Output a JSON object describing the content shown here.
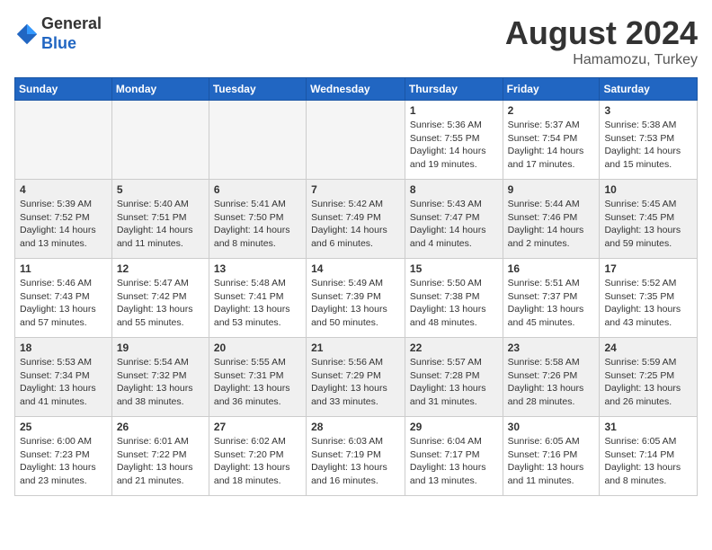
{
  "header": {
    "logo_line1": "General",
    "logo_line2": "Blue",
    "month_year": "August 2024",
    "location": "Hamamozu, Turkey"
  },
  "weekdays": [
    "Sunday",
    "Monday",
    "Tuesday",
    "Wednesday",
    "Thursday",
    "Friday",
    "Saturday"
  ],
  "weeks": [
    [
      {
        "day": "",
        "empty": true
      },
      {
        "day": "",
        "empty": true
      },
      {
        "day": "",
        "empty": true
      },
      {
        "day": "",
        "empty": true
      },
      {
        "day": "1",
        "sunrise": "5:36 AM",
        "sunset": "7:55 PM",
        "daylight": "14 hours and 19 minutes."
      },
      {
        "day": "2",
        "sunrise": "5:37 AM",
        "sunset": "7:54 PM",
        "daylight": "14 hours and 17 minutes."
      },
      {
        "day": "3",
        "sunrise": "5:38 AM",
        "sunset": "7:53 PM",
        "daylight": "14 hours and 15 minutes."
      }
    ],
    [
      {
        "day": "4",
        "sunrise": "5:39 AM",
        "sunset": "7:52 PM",
        "daylight": "14 hours and 13 minutes."
      },
      {
        "day": "5",
        "sunrise": "5:40 AM",
        "sunset": "7:51 PM",
        "daylight": "14 hours and 11 minutes."
      },
      {
        "day": "6",
        "sunrise": "5:41 AM",
        "sunset": "7:50 PM",
        "daylight": "14 hours and 8 minutes."
      },
      {
        "day": "7",
        "sunrise": "5:42 AM",
        "sunset": "7:49 PM",
        "daylight": "14 hours and 6 minutes."
      },
      {
        "day": "8",
        "sunrise": "5:43 AM",
        "sunset": "7:47 PM",
        "daylight": "14 hours and 4 minutes."
      },
      {
        "day": "9",
        "sunrise": "5:44 AM",
        "sunset": "7:46 PM",
        "daylight": "14 hours and 2 minutes."
      },
      {
        "day": "10",
        "sunrise": "5:45 AM",
        "sunset": "7:45 PM",
        "daylight": "13 hours and 59 minutes."
      }
    ],
    [
      {
        "day": "11",
        "sunrise": "5:46 AM",
        "sunset": "7:43 PM",
        "daylight": "13 hours and 57 minutes."
      },
      {
        "day": "12",
        "sunrise": "5:47 AM",
        "sunset": "7:42 PM",
        "daylight": "13 hours and 55 minutes."
      },
      {
        "day": "13",
        "sunrise": "5:48 AM",
        "sunset": "7:41 PM",
        "daylight": "13 hours and 53 minutes."
      },
      {
        "day": "14",
        "sunrise": "5:49 AM",
        "sunset": "7:39 PM",
        "daylight": "13 hours and 50 minutes."
      },
      {
        "day": "15",
        "sunrise": "5:50 AM",
        "sunset": "7:38 PM",
        "daylight": "13 hours and 48 minutes."
      },
      {
        "day": "16",
        "sunrise": "5:51 AM",
        "sunset": "7:37 PM",
        "daylight": "13 hours and 45 minutes."
      },
      {
        "day": "17",
        "sunrise": "5:52 AM",
        "sunset": "7:35 PM",
        "daylight": "13 hours and 43 minutes."
      }
    ],
    [
      {
        "day": "18",
        "sunrise": "5:53 AM",
        "sunset": "7:34 PM",
        "daylight": "13 hours and 41 minutes."
      },
      {
        "day": "19",
        "sunrise": "5:54 AM",
        "sunset": "7:32 PM",
        "daylight": "13 hours and 38 minutes."
      },
      {
        "day": "20",
        "sunrise": "5:55 AM",
        "sunset": "7:31 PM",
        "daylight": "13 hours and 36 minutes."
      },
      {
        "day": "21",
        "sunrise": "5:56 AM",
        "sunset": "7:29 PM",
        "daylight": "13 hours and 33 minutes."
      },
      {
        "day": "22",
        "sunrise": "5:57 AM",
        "sunset": "7:28 PM",
        "daylight": "13 hours and 31 minutes."
      },
      {
        "day": "23",
        "sunrise": "5:58 AM",
        "sunset": "7:26 PM",
        "daylight": "13 hours and 28 minutes."
      },
      {
        "day": "24",
        "sunrise": "5:59 AM",
        "sunset": "7:25 PM",
        "daylight": "13 hours and 26 minutes."
      }
    ],
    [
      {
        "day": "25",
        "sunrise": "6:00 AM",
        "sunset": "7:23 PM",
        "daylight": "13 hours and 23 minutes."
      },
      {
        "day": "26",
        "sunrise": "6:01 AM",
        "sunset": "7:22 PM",
        "daylight": "13 hours and 21 minutes."
      },
      {
        "day": "27",
        "sunrise": "6:02 AM",
        "sunset": "7:20 PM",
        "daylight": "13 hours and 18 minutes."
      },
      {
        "day": "28",
        "sunrise": "6:03 AM",
        "sunset": "7:19 PM",
        "daylight": "13 hours and 16 minutes."
      },
      {
        "day": "29",
        "sunrise": "6:04 AM",
        "sunset": "7:17 PM",
        "daylight": "13 hours and 13 minutes."
      },
      {
        "day": "30",
        "sunrise": "6:05 AM",
        "sunset": "7:16 PM",
        "daylight": "13 hours and 11 minutes."
      },
      {
        "day": "31",
        "sunrise": "6:05 AM",
        "sunset": "7:14 PM",
        "daylight": "13 hours and 8 minutes."
      }
    ]
  ]
}
